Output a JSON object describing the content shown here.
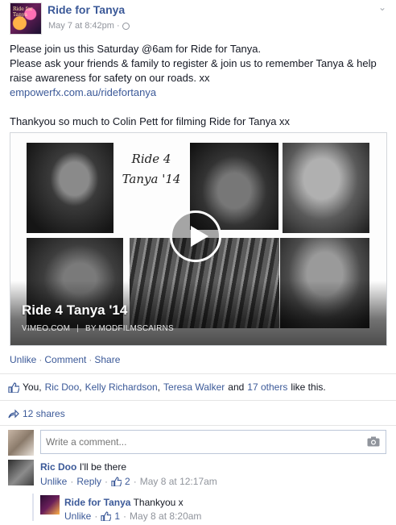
{
  "post": {
    "page_name": "Ride for Tanya",
    "timestamp": "May 7 at 8:42pm",
    "meta_sep": "·",
    "avatar_text": "Ride for Tanya",
    "lines": [
      "Please join us this Saturday @6am for Ride for Tanya.",
      "Please ask your friends & family to register & join us to remember Tanya & help raise awareness for safety on our roads. xx"
    ],
    "link": "empowerfx.com.au/ridefortanya",
    "thanks": "Thankyou so much to Colin Pett for filming Ride for Tanya xx"
  },
  "video": {
    "collage_title": "Ride 4 Tanya '14",
    "title": "Ride 4 Tanya '14",
    "source": "VIMEO.COM",
    "sep": "|",
    "author": "BY MODFILMSCAIRNS"
  },
  "actions": {
    "unlike": "Unlike",
    "comment": "Comment",
    "share": "Share",
    "dot": "·"
  },
  "likes": {
    "you": "You,",
    "names": [
      "Ric Doo",
      "Kelly Richardson",
      "Teresa Walker"
    ],
    "sep": ",",
    "and": "and",
    "others": "17 others",
    "suffix": "like this."
  },
  "shares": {
    "label": "12 shares"
  },
  "comment_box": {
    "placeholder": "Write a comment..."
  },
  "comments": [
    {
      "author": "Ric Doo",
      "text": "I'll be there",
      "unlike": "Unlike",
      "reply": "Reply",
      "likes": "2",
      "time": "May 8 at 12:17am",
      "dot": "·"
    },
    {
      "author": "Ride for Tanya",
      "text": "Thankyou x",
      "unlike": "Unlike",
      "likes": "1",
      "time": "May 8 at 8:20am",
      "dot": "·"
    }
  ],
  "colors": {
    "link": "#3b5998",
    "muted": "#90949c",
    "text": "#141823"
  },
  "icons": [
    "globe-icon",
    "chevron-down-icon",
    "play-icon",
    "thumbs-up-icon",
    "share-arrow-icon",
    "camera-icon"
  ]
}
